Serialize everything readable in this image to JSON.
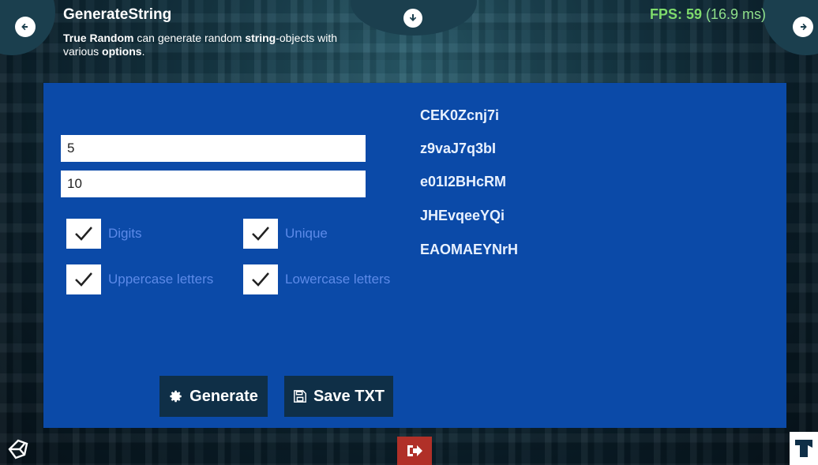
{
  "header": {
    "title": "GenerateString",
    "desc_bold1": "True Random",
    "desc_text1": " can generate random ",
    "desc_bold2": "string",
    "desc_text2": "-objects with various ",
    "desc_bold3": "options",
    "desc_text3": "."
  },
  "fps": {
    "label": "FPS: 59",
    "ms": " (16.9 ms)"
  },
  "form": {
    "input1_value": "5",
    "input2_value": "10"
  },
  "options": [
    {
      "label": "Digits",
      "checked": true
    },
    {
      "label": "Unique",
      "checked": true
    },
    {
      "label": "Uppercase letters",
      "checked": true
    },
    {
      "label": "Lowercase letters",
      "checked": true
    }
  ],
  "results": [
    "CEK0Zcnj7i",
    "z9vaJ7q3bI",
    "e01I2BHcRM",
    "JHEvqeeYQi",
    "EAOMAEYNrH"
  ],
  "buttons": {
    "generate": "Generate",
    "save": "Save TXT"
  },
  "icons": {
    "prev": "arrow-left-circle-icon",
    "next": "arrow-right-circle-icon",
    "down": "arrow-down-circle-icon",
    "generate": "gear-icon",
    "save": "floppy-disk-icon",
    "exit": "sign-out-icon",
    "unity": "unity-logo-icon",
    "brand": "brand-logo-icon"
  },
  "colors": {
    "panel": "#0b4aa8",
    "button": "#0f2f47",
    "fps": "#7fdc6c",
    "exit": "#b03028",
    "option_label": "#5c8ae8"
  }
}
